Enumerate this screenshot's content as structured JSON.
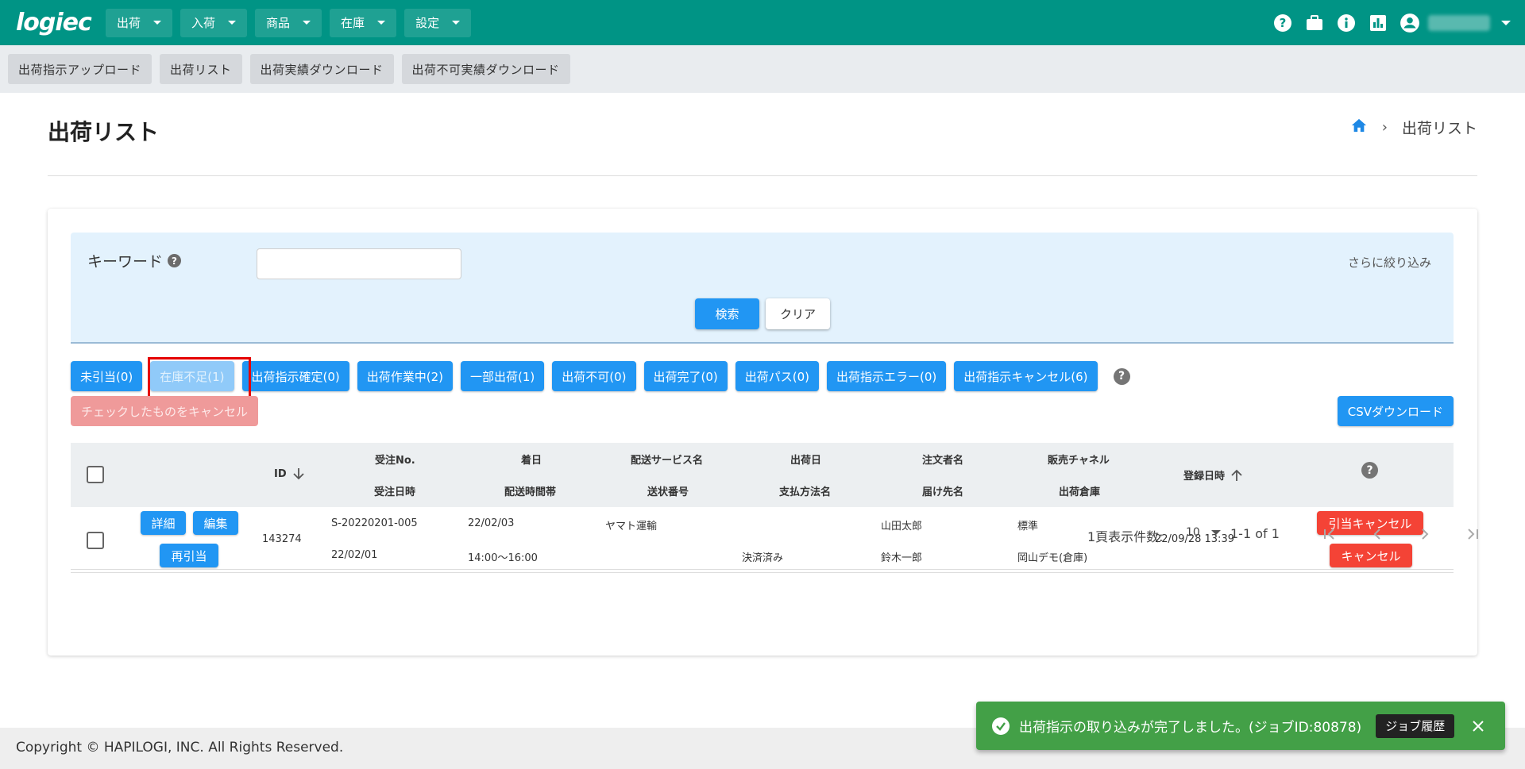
{
  "app": {
    "logo": "logiec"
  },
  "topnav": [
    {
      "label": "出荷"
    },
    {
      "label": "入荷"
    },
    {
      "label": "商品"
    },
    {
      "label": "在庫"
    },
    {
      "label": "設定"
    }
  ],
  "topbar_icons": [
    "help-icon",
    "briefcase-icon",
    "info-icon",
    "chart-icon",
    "account-icon"
  ],
  "subnav": [
    {
      "label": "出荷指示アップロード"
    },
    {
      "label": "出荷リスト"
    },
    {
      "label": "出荷実績ダウンロード"
    },
    {
      "label": "出荷不可実績ダウンロード"
    }
  ],
  "page": {
    "title": "出荷リスト"
  },
  "breadcrumb": {
    "current": "出荷リスト"
  },
  "search": {
    "keyword_label": "キーワード",
    "keyword_value": "",
    "more_filter": "さらに絞り込み",
    "search_button": "検索",
    "clear_button": "クリア"
  },
  "status_filters": [
    {
      "label": "未引当(0)"
    },
    {
      "label": "在庫不足(1)"
    },
    {
      "label": "出荷指示確定(0)"
    },
    {
      "label": "出荷作業中(2)"
    },
    {
      "label": "一部出荷(1)"
    },
    {
      "label": "出荷不可(0)"
    },
    {
      "label": "出荷完了(0)"
    },
    {
      "label": "出荷パス(0)"
    },
    {
      "label": "出荷指示エラー(0)"
    },
    {
      "label": "出荷指示キャンセル(6)"
    }
  ],
  "actions": {
    "bulk_cancel": "チェックしたものをキャンセル",
    "csv_download": "CSVダウンロード"
  },
  "table": {
    "headers": {
      "id": "ID",
      "order_no": "受注No.",
      "order_datetime": "受注日時",
      "arrival_date": "着日",
      "delivery_time": "配送時間帯",
      "delivery_service": "配送サービス名",
      "tracking_no": "送状番号",
      "ship_date": "出荷日",
      "payment_method": "支払方法名",
      "orderer_name": "注文者名",
      "recipient_name": "届け先名",
      "sales_channel": "販売チャネル",
      "warehouse": "出荷倉庫",
      "registered_at": "登録日時"
    },
    "rows": [
      {
        "detail_button": "詳細",
        "edit_button": "編集",
        "reallocate_button": "再引当",
        "id": "143274",
        "order_no": "S-20220201-005",
        "order_datetime": "22/02/01",
        "arrival_date": "22/02/03",
        "delivery_time": "14:00～16:00",
        "delivery_service": "ヤマト運輸",
        "tracking_no": "",
        "ship_date": "",
        "payment_method": "決済済み",
        "orderer_name": "山田太郎",
        "recipient_name": "鈴木一郎",
        "sales_channel": "標準",
        "warehouse": "岡山デモ(倉庫)",
        "registered_at": "22/09/28 13:39",
        "alloc_cancel_button": "引当キャンセル",
        "cancel_button": "キャンセル"
      }
    ]
  },
  "pagination": {
    "per_page_label": "1頁表示件数:",
    "per_page_value": "10",
    "range": "1-1 of 1"
  },
  "footer": {
    "copyright": "Copyright © HAPILOGI, INC. All Rights Reserved."
  },
  "snackbar": {
    "message": "出荷指示の取り込みが完了しました。(ジョブID:80878)",
    "button": "ジョブ履歴"
  },
  "colors": {
    "header": "#009485",
    "primary": "#2196f3",
    "danger": "#f44336",
    "success": "#43a047",
    "highlight": "#e50000"
  }
}
